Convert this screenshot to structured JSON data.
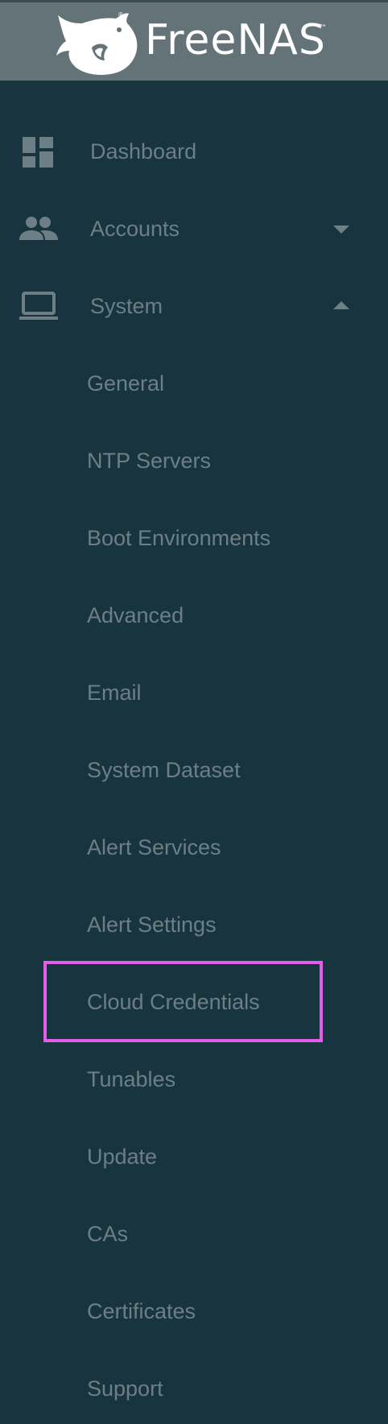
{
  "brand": {
    "name": "FreeNAS",
    "trademark": "™",
    "registered": "®"
  },
  "colors": {
    "sidebar_bg": "#17343f",
    "header_bg": "#637378",
    "text_muted": "#6d7f84",
    "highlight": "#e15ee8"
  },
  "nav": {
    "dashboard": {
      "label": "Dashboard",
      "icon": "dashboard-icon"
    },
    "accounts": {
      "label": "Accounts",
      "icon": "people-icon",
      "expanded": false
    },
    "system": {
      "label": "System",
      "icon": "laptop-icon",
      "expanded": true
    }
  },
  "system_submenu": [
    {
      "label": "General"
    },
    {
      "label": "NTP Servers"
    },
    {
      "label": "Boot Environments"
    },
    {
      "label": "Advanced"
    },
    {
      "label": "Email"
    },
    {
      "label": "System Dataset"
    },
    {
      "label": "Alert Services"
    },
    {
      "label": "Alert Settings"
    },
    {
      "label": "Cloud Credentials",
      "highlighted": true
    },
    {
      "label": "Tunables"
    },
    {
      "label": "Update"
    },
    {
      "label": "CAs"
    },
    {
      "label": "Certificates"
    },
    {
      "label": "Support"
    }
  ]
}
